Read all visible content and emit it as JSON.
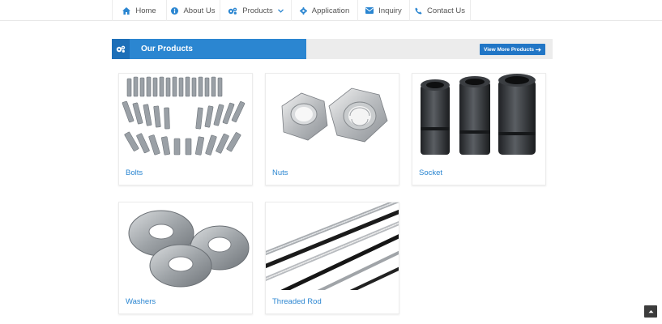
{
  "nav": {
    "items": [
      {
        "label": "Home",
        "icon": "home-icon"
      },
      {
        "label": "About Us",
        "icon": "info-icon"
      },
      {
        "label": "Products",
        "icon": "gears-icon",
        "dropdown": true
      },
      {
        "label": "Application",
        "icon": "gear-icon"
      },
      {
        "label": "Inquiry",
        "icon": "envelope-icon"
      },
      {
        "label": "Contact Us",
        "icon": "phone-icon"
      }
    ]
  },
  "section": {
    "title": "Our Products",
    "icon": "gears-icon",
    "button_label": "View More Products",
    "button_icon": "arrow-right-icon"
  },
  "products": [
    {
      "label": "Bolts",
      "image": "bolts-image"
    },
    {
      "label": "Nuts",
      "image": "nuts-image"
    },
    {
      "label": "Socket",
      "image": "socket-image"
    },
    {
      "label": "Washers",
      "image": "washers-image"
    },
    {
      "label": "Threaded Rod",
      "image": "threaded-rod-image"
    }
  ],
  "colors": {
    "accent": "#2b86d1",
    "accent_dark": "#1d6fb8",
    "section_bg": "#ececec"
  },
  "scroll_top": {
    "icon": "chevron-up-icon"
  }
}
